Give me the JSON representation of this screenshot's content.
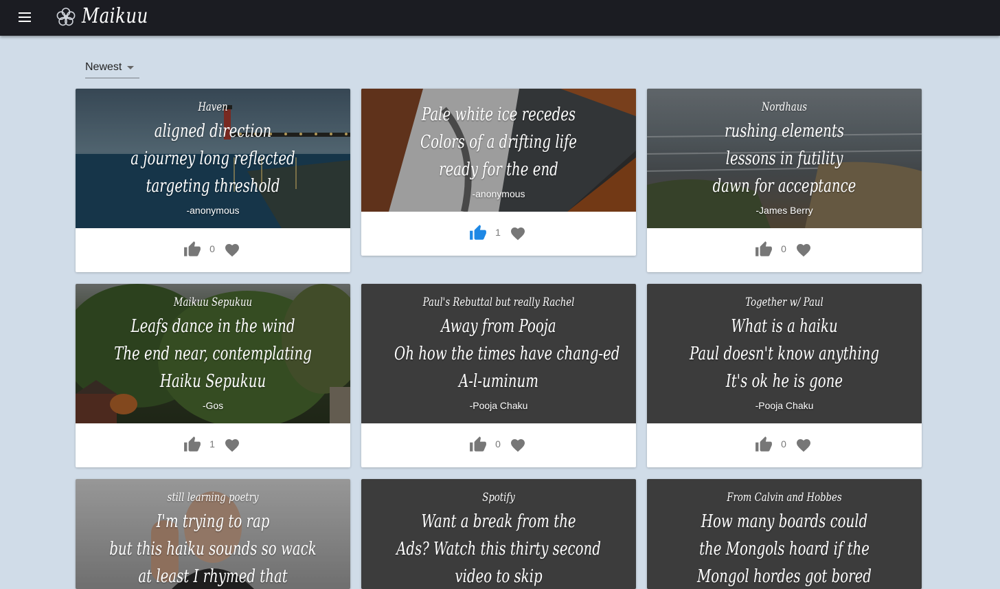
{
  "app": {
    "title": "Maikuu",
    "menu_icon": "menu-icon",
    "logo_icon": "flower-logo-icon"
  },
  "sort": {
    "selected": "Newest"
  },
  "colors": {
    "appbar": "#1b1c22",
    "page_bg": "#d0dce8",
    "like_active": "#1e88e5",
    "icon_inactive": "#777777"
  },
  "cards": [
    {
      "title": "Haven",
      "lines": [
        "aligned direction",
        "a journey long reflected",
        "targeting threshold"
      ],
      "author": "-anonymous",
      "likes": "0",
      "liked": false,
      "image": "lighthouse pier at dusk"
    },
    {
      "title": "",
      "lines": [
        "Pale white ice recedes",
        "Colors of a drifting life",
        "ready for the end"
      ],
      "author": "-anonymous",
      "likes": "1",
      "liked": true,
      "image": "snowy autumn riverbank"
    },
    {
      "title": "Nordhaus",
      "lines": [
        "rushing elements",
        "lessons in futility",
        "dawn for acceptance"
      ],
      "author": "-James Berry",
      "likes": "0",
      "liked": false,
      "image": "stormy lake shore"
    },
    {
      "title": "Maikuu Sepukuu",
      "lines": [
        "Leafs dance in the wind",
        "The end near, contemplating",
        "Haiku Sepukuu"
      ],
      "author": "-Gos",
      "likes": "1",
      "liked": false,
      "image": "autumn trees and house"
    },
    {
      "title": "Paul's Rebuttal but really Rachel",
      "lines": [
        "Away from Pooja",
        "Oh how the times have chang-ed",
        "A-l-uminum"
      ],
      "author": "-Pooja Chaku",
      "likes": "0",
      "liked": false,
      "image": ""
    },
    {
      "title": "Together w/ Paul",
      "lines": [
        "What is a haiku",
        "Paul doesn't know anything",
        "It's ok he is gone"
      ],
      "author": "-Pooja Chaku",
      "likes": "0",
      "liked": false,
      "image": ""
    },
    {
      "title": "still learning poetry",
      "lines": [
        "I'm trying to rap",
        "but this haiku sounds so wack",
        "at least I rhymed that"
      ],
      "author": "",
      "likes": "",
      "liked": false,
      "image": "rapper portrait"
    },
    {
      "title": "Spotify",
      "lines": [
        "Want a break from the",
        "Ads? Watch this thirty second",
        "video to skip"
      ],
      "author": "",
      "likes": "",
      "liked": false,
      "image": ""
    },
    {
      "title": "From Calvin and Hobbes",
      "lines": [
        "How many boards could",
        "the Mongols hoard if the",
        "Mongol hordes got bored"
      ],
      "author": "",
      "likes": "",
      "liked": false,
      "image": ""
    }
  ]
}
